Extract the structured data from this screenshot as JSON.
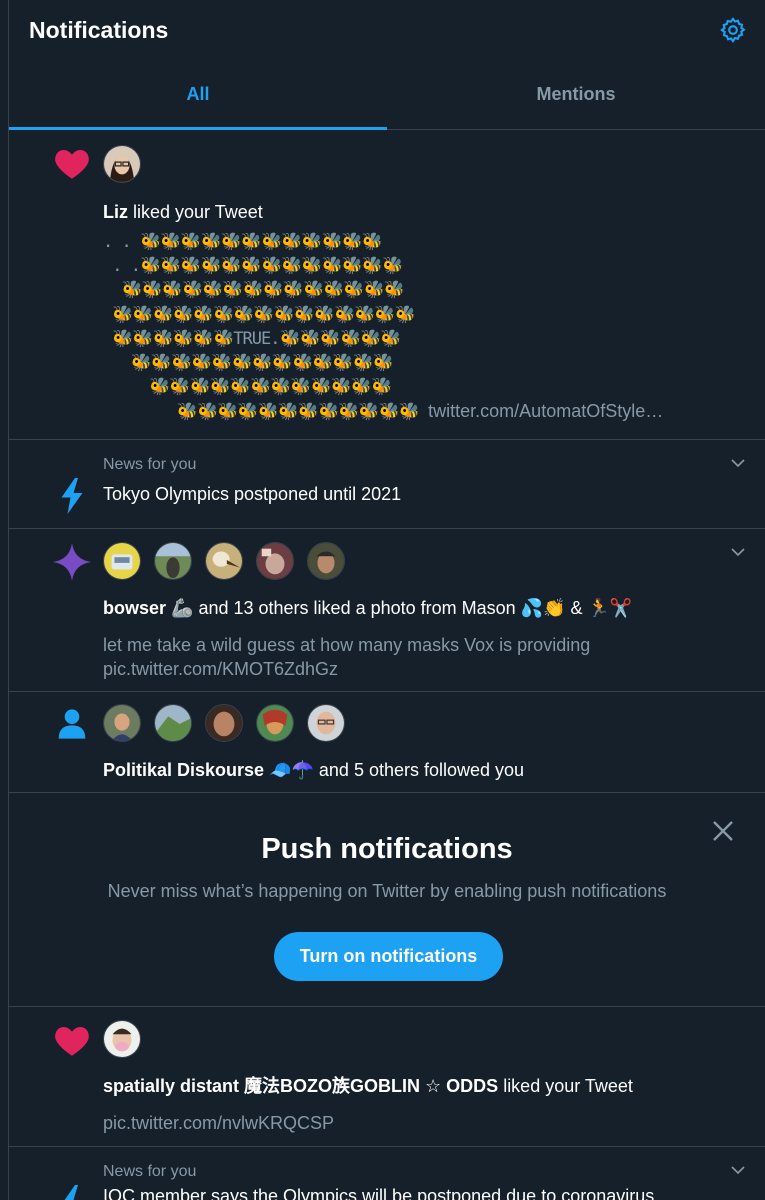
{
  "header": {
    "title": "Notifications",
    "settings_icon": "gear-icon"
  },
  "tabs": [
    {
      "label": "All",
      "active": true
    },
    {
      "label": "Mentions",
      "active": false
    }
  ],
  "notif1": {
    "icon": "heart-icon",
    "user": "Liz",
    "action": " liked your Tweet",
    "art_word": "TRUE.",
    "link": "twitter.com/AutomatOfStyle…"
  },
  "notif2": {
    "icon": "bolt-icon",
    "label": "News for you",
    "text": "Tokyo Olympics postponed until 2021"
  },
  "notif3": {
    "icon": "sparkle-icon",
    "user": "bowser",
    "user_emoji": "🦾",
    "action": " and 13 others liked a photo from Mason ",
    "emoji_tail": "💦👏 & 🏃✂️",
    "tweet_text": "let me take a wild guess at how many masks Vox is providing",
    "tweet_link": "pic.twitter.com/KMOT6ZdhGz"
  },
  "notif4": {
    "icon": "person-icon",
    "user": "Politikal Diskourse",
    "user_emoji": "🧢☂️",
    "action": " and 5 others followed you"
  },
  "push": {
    "title": "Push notifications",
    "description": "Never miss what’s happening on Twitter by enabling push notifications",
    "button": "Turn on notifications",
    "close_icon": "close-icon"
  },
  "notif5": {
    "icon": "heart-icon",
    "user": "spatially distant 魔法BOZO族GOBLIN ☆ ODDS",
    "action": " liked your Tweet",
    "tweet_link": "pic.twitter.com/nvlwKRQCSP"
  },
  "notif6": {
    "icon": "bolt-icon",
    "label": "News for you",
    "text": "IOC member says the Olympics will be postponed due to coronavirus"
  },
  "colors": {
    "background": "#15202b",
    "accent": "#1da1f2",
    "heart": "#e0245e",
    "sparkle": "#794bc4",
    "border": "#38444d",
    "muted": "#8899a6"
  }
}
